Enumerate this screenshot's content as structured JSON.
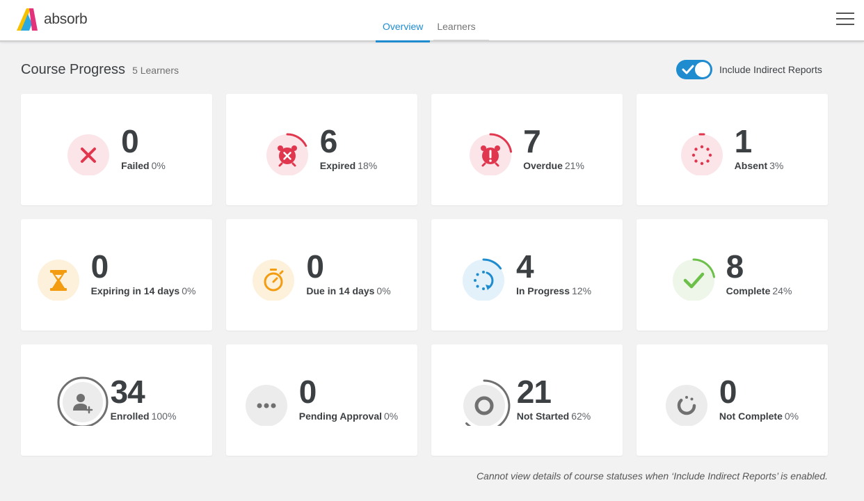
{
  "app": {
    "brand": "absorb"
  },
  "nav": {
    "tabs": [
      {
        "label": "Overview",
        "active": true
      },
      {
        "label": "Learners",
        "active": false
      }
    ]
  },
  "header": {
    "title": "Course Progress",
    "learner_count": "5 Learners"
  },
  "toggle": {
    "label": "Include Indirect Reports",
    "on": true
  },
  "cards": [
    {
      "value": "0",
      "label": "Failed",
      "percent": "0%",
      "icon": "x-icon"
    },
    {
      "value": "6",
      "label": "Expired",
      "percent": "18%",
      "icon": "alarm-x-icon"
    },
    {
      "value": "7",
      "label": "Overdue",
      "percent": "21%",
      "icon": "alarm-exclamation-icon"
    },
    {
      "value": "1",
      "label": "Absent",
      "percent": "3%",
      "icon": "dotted-circle-icon"
    },
    {
      "value": "0",
      "label": "Expiring in 14 days",
      "percent": "0%",
      "icon": "hourglass-icon"
    },
    {
      "value": "0",
      "label": "Due in 14 days",
      "percent": "0%",
      "icon": "stopwatch-icon"
    },
    {
      "value": "4",
      "label": "In Progress",
      "percent": "12%",
      "icon": "progress-arrow-icon"
    },
    {
      "value": "8",
      "label": "Complete",
      "percent": "24%",
      "icon": "checkmark-icon"
    },
    {
      "value": "34",
      "label": "Enrolled",
      "percent": "100%",
      "icon": "user-plus-icon"
    },
    {
      "value": "0",
      "label": "Pending Approval",
      "percent": "0%",
      "icon": "ellipsis-icon"
    },
    {
      "value": "21",
      "label": "Not Started",
      "percent": "62%",
      "icon": "ring-icon"
    },
    {
      "value": "0",
      "label": "Not Complete",
      "percent": "0%",
      "icon": "partial-spinner-icon"
    }
  ],
  "footnote": "Cannot view details of course statuses when ‘Include Indirect Reports’ is enabled.",
  "colors": {
    "accent": "#1f8cd0",
    "danger": "#e0374f",
    "warning": "#f39c12",
    "success": "#6cc04a",
    "neutral": "#707070"
  }
}
